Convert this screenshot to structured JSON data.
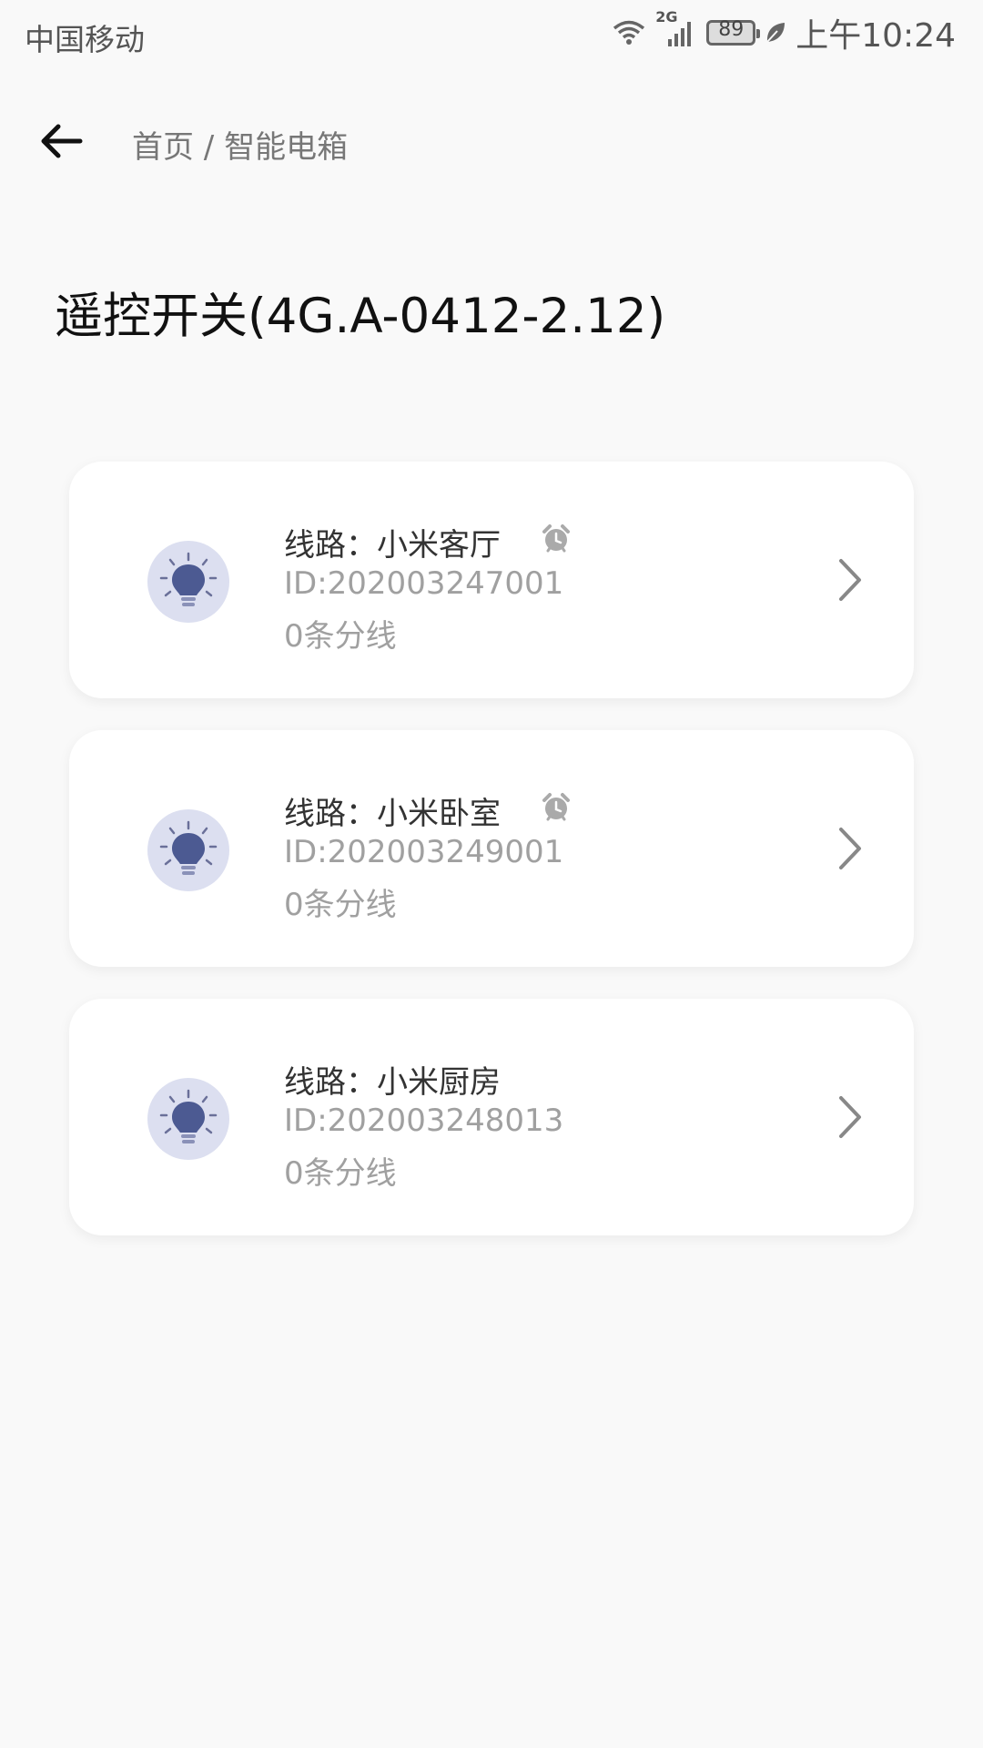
{
  "status_bar": {
    "carrier": "中国移动",
    "network": "2G",
    "battery": "89",
    "time": "上午10:24"
  },
  "nav": {
    "breadcrumb": "首页 / 智能电箱"
  },
  "device_title": "遥控开关(4G.A-0412-2.12)",
  "lines": [
    {
      "name": "线路：小米客厅",
      "id": "ID:202003247001",
      "sub": "0条分线",
      "alarm": true
    },
    {
      "name": "线路：小米卧室",
      "id": "ID:202003249001",
      "sub": "0条分线",
      "alarm": true
    },
    {
      "name": "线路：小米厨房",
      "id": "ID:202003248013",
      "sub": "0条分线",
      "alarm": false
    }
  ],
  "icons": {
    "bulb": "light-bulb-icon",
    "alarm": "alarm-clock-icon",
    "chevron": "chevron-right-icon",
    "back": "back-arrow-icon"
  },
  "colors": {
    "bulb_bg": "#dcdff0",
    "bulb_fg": "#4c5a92",
    "background": "#f9f9f9"
  }
}
